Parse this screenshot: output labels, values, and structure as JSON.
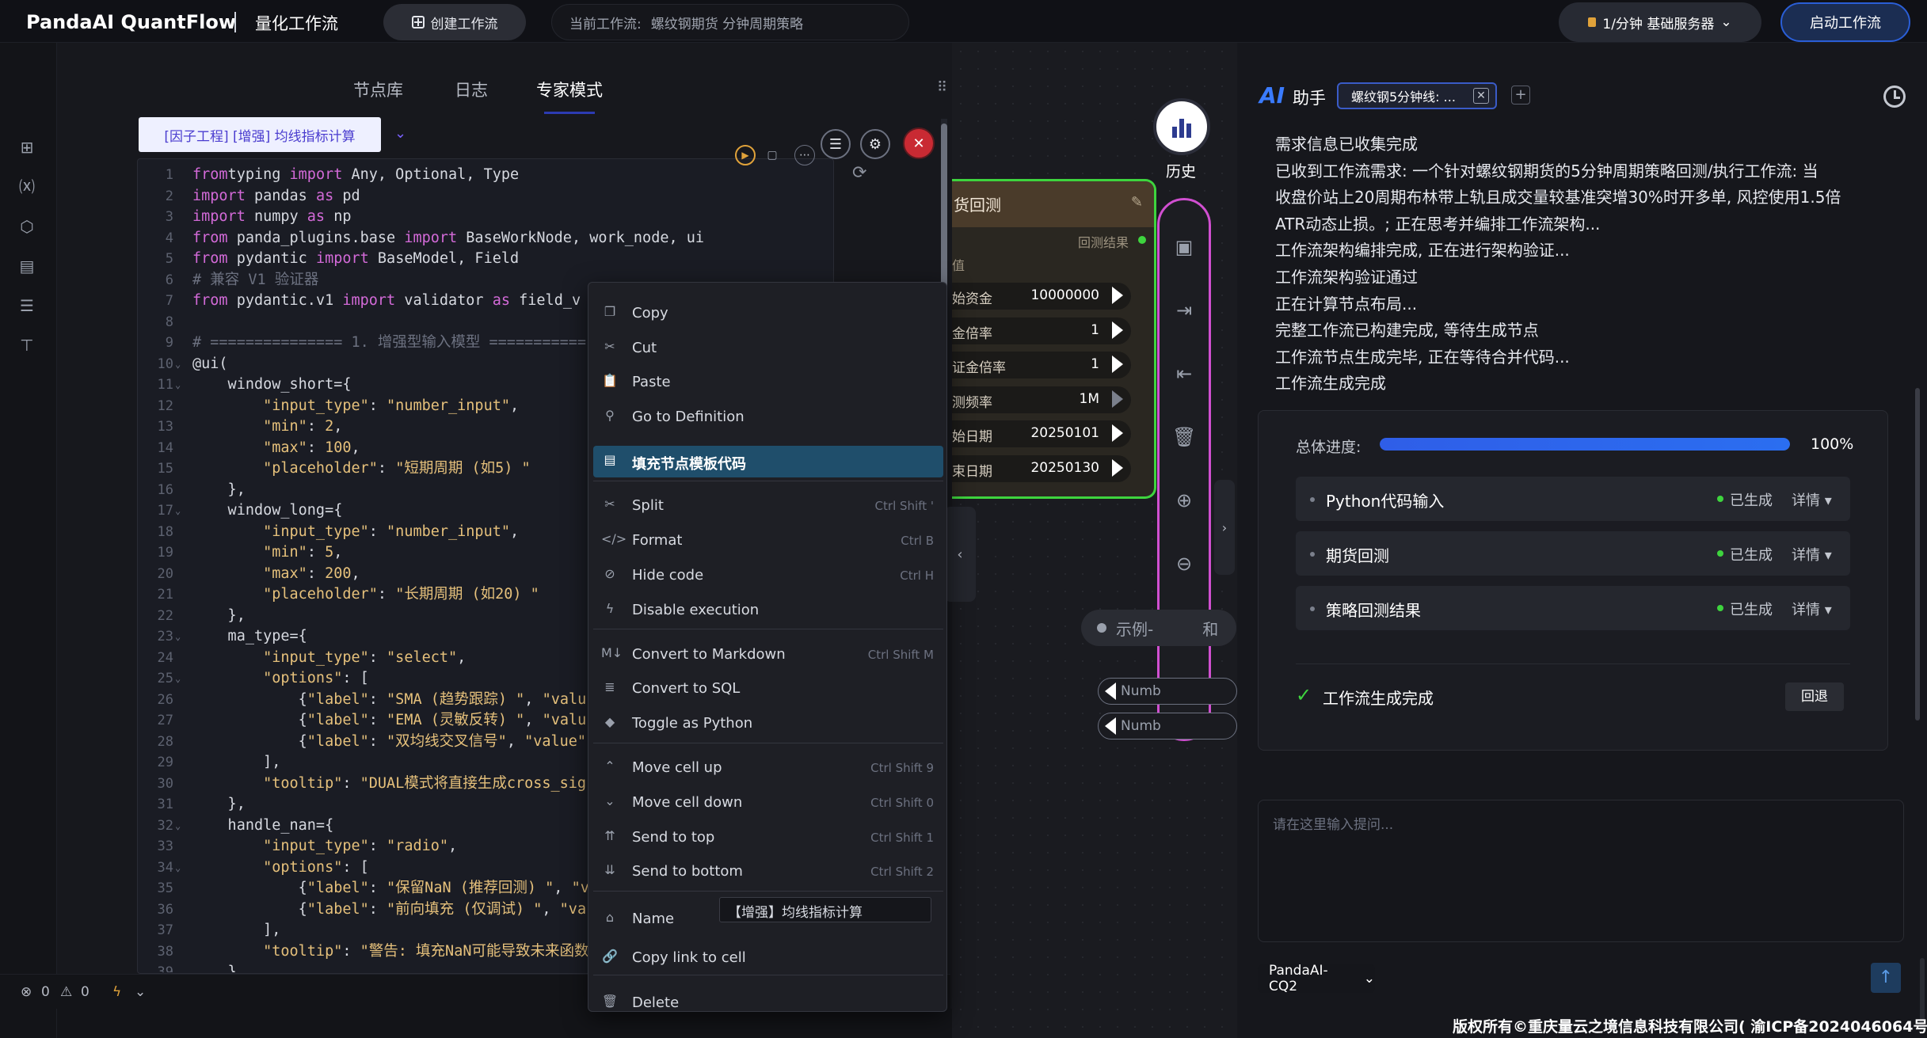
{
  "topbar": {
    "brand": "PandaAI QuantFlow",
    "subtitle": "量化工作流",
    "create_label": "创建工作流",
    "current_flow_label": "当前工作流:",
    "current_flow_value": "螺纹钢期货 分钟周期策略",
    "server_label": "1/分钟  基础服务器",
    "start_label": "启动工作流"
  },
  "editor": {
    "tabs": [
      "节点库",
      "日志",
      "专家模式"
    ],
    "active_tab": "专家模式",
    "cell_tag": "[因子工程] [增强] 均线指标计算",
    "lines": [
      {
        "n": "1",
        "t": [
          [
            "kw",
            "from"
          ],
          [
            "",
            "typing "
          ],
          [
            "kw",
            "import"
          ],
          [
            "",
            " Any, Optional, Type"
          ]
        ]
      },
      {
        "n": "2",
        "t": [
          [
            "kw",
            "import"
          ],
          [
            "",
            " pandas "
          ],
          [
            "kw",
            "as"
          ],
          [
            "",
            " pd"
          ]
        ]
      },
      {
        "n": "3",
        "t": [
          [
            "kw",
            "import"
          ],
          [
            "",
            " numpy "
          ],
          [
            "kw",
            "as"
          ],
          [
            "",
            " np"
          ]
        ]
      },
      {
        "n": "4",
        "t": [
          [
            "kw",
            "from"
          ],
          [
            "",
            " panda_plugins.base "
          ],
          [
            "kw",
            "import"
          ],
          [
            "",
            " BaseWorkNode, work_node, ui"
          ]
        ]
      },
      {
        "n": "5",
        "t": [
          [
            "kw",
            "from"
          ],
          [
            "",
            " pydantic "
          ],
          [
            "kw",
            "import"
          ],
          [
            "",
            " BaseModel, Field"
          ]
        ]
      },
      {
        "n": "6",
        "t": [
          [
            "cm",
            "# 兼容 V1 验证器"
          ]
        ]
      },
      {
        "n": "7",
        "t": [
          [
            "kw",
            "from"
          ],
          [
            "",
            " pydantic.v1 "
          ],
          [
            "kw",
            "import"
          ],
          [
            "",
            " validator "
          ],
          [
            "kw",
            "as"
          ],
          [
            "",
            " field_v"
          ]
        ]
      },
      {
        "n": "8",
        "t": []
      },
      {
        "n": "9",
        "t": [
          [
            "cm",
            "# =============== 1. 增强型输入模型 ==========="
          ]
        ]
      },
      {
        "n": "10",
        "f": true,
        "t": [
          [
            "",
            "@ui("
          ]
        ]
      },
      {
        "n": "11",
        "f": true,
        "t": [
          [
            "",
            "    window_short={"
          ]
        ]
      },
      {
        "n": "12",
        "t": [
          [
            "",
            "        "
          ],
          [
            "str",
            "\"input_type\""
          ],
          [
            "",
            ": "
          ],
          [
            "str",
            "\"number_input\""
          ],
          [
            "",
            ","
          ]
        ]
      },
      {
        "n": "13",
        "t": [
          [
            "",
            "        "
          ],
          [
            "str",
            "\"min\""
          ],
          [
            "",
            ": "
          ],
          [
            "num",
            "2"
          ],
          [
            "",
            ","
          ]
        ]
      },
      {
        "n": "14",
        "t": [
          [
            "",
            "        "
          ],
          [
            "str",
            "\"max\""
          ],
          [
            "",
            ": "
          ],
          [
            "num",
            "100"
          ],
          [
            "",
            ","
          ]
        ]
      },
      {
        "n": "15",
        "t": [
          [
            "",
            "        "
          ],
          [
            "str",
            "\"placeholder\""
          ],
          [
            "",
            ": "
          ],
          [
            "str",
            "\"短期周期 (如5) \""
          ]
        ]
      },
      {
        "n": "16",
        "t": [
          [
            "",
            "    },"
          ]
        ]
      },
      {
        "n": "17",
        "f": true,
        "t": [
          [
            "",
            "    window_long={"
          ]
        ]
      },
      {
        "n": "18",
        "t": [
          [
            "",
            "        "
          ],
          [
            "str",
            "\"input_type\""
          ],
          [
            "",
            ": "
          ],
          [
            "str",
            "\"number_input\""
          ],
          [
            "",
            ","
          ]
        ]
      },
      {
        "n": "19",
        "t": [
          [
            "",
            "        "
          ],
          [
            "str",
            "\"min\""
          ],
          [
            "",
            ": "
          ],
          [
            "num",
            "5"
          ],
          [
            "",
            ","
          ]
        ]
      },
      {
        "n": "20",
        "t": [
          [
            "",
            "        "
          ],
          [
            "str",
            "\"max\""
          ],
          [
            "",
            ": "
          ],
          [
            "num",
            "200"
          ],
          [
            "",
            ","
          ]
        ]
      },
      {
        "n": "21",
        "t": [
          [
            "",
            "        "
          ],
          [
            "str",
            "\"placeholder\""
          ],
          [
            "",
            ": "
          ],
          [
            "str",
            "\"长期周期 (如20) \""
          ]
        ]
      },
      {
        "n": "22",
        "t": [
          [
            "",
            "    },"
          ]
        ]
      },
      {
        "n": "23",
        "f": true,
        "t": [
          [
            "",
            "    ma_type={"
          ]
        ]
      },
      {
        "n": "24",
        "t": [
          [
            "",
            "        "
          ],
          [
            "str",
            "\"input_type\""
          ],
          [
            "",
            ": "
          ],
          [
            "str",
            "\"select\""
          ],
          [
            "",
            ","
          ]
        ]
      },
      {
        "n": "25",
        "f": true,
        "t": [
          [
            "",
            "        "
          ],
          [
            "str",
            "\"options\""
          ],
          [
            "",
            ": ["
          ]
        ]
      },
      {
        "n": "26",
        "t": [
          [
            "",
            "            {"
          ],
          [
            "str",
            "\"label\""
          ],
          [
            "",
            ": "
          ],
          [
            "str",
            "\"SMA (趋势跟踪) \""
          ],
          [
            "",
            ", "
          ],
          [
            "str",
            "\"valu"
          ]
        ]
      },
      {
        "n": "27",
        "t": [
          [
            "",
            "            {"
          ],
          [
            "str",
            "\"label\""
          ],
          [
            "",
            ": "
          ],
          [
            "str",
            "\"EMA (灵敏反转) \""
          ],
          [
            "",
            ", "
          ],
          [
            "str",
            "\"valu"
          ]
        ]
      },
      {
        "n": "28",
        "t": [
          [
            "",
            "            {"
          ],
          [
            "str",
            "\"label\""
          ],
          [
            "",
            ": "
          ],
          [
            "str",
            "\"双均线交叉信号\""
          ],
          [
            "",
            ", "
          ],
          [
            "str",
            "\"value\""
          ]
        ]
      },
      {
        "n": "29",
        "t": [
          [
            "",
            "        ],"
          ]
        ]
      },
      {
        "n": "30",
        "t": [
          [
            "",
            "        "
          ],
          [
            "str",
            "\"tooltip\""
          ],
          [
            "",
            ": "
          ],
          [
            "str",
            "\"DUAL模式将直接生成cross_sig"
          ]
        ]
      },
      {
        "n": "31",
        "t": [
          [
            "",
            "    },"
          ]
        ]
      },
      {
        "n": "32",
        "f": true,
        "t": [
          [
            "",
            "    handle_nan={"
          ]
        ]
      },
      {
        "n": "33",
        "t": [
          [
            "",
            "        "
          ],
          [
            "str",
            "\"input_type\""
          ],
          [
            "",
            ": "
          ],
          [
            "str",
            "\"radio\""
          ],
          [
            "",
            ","
          ]
        ]
      },
      {
        "n": "34",
        "f": true,
        "t": [
          [
            "",
            "        "
          ],
          [
            "str",
            "\"options\""
          ],
          [
            "",
            ": ["
          ]
        ]
      },
      {
        "n": "35",
        "t": [
          [
            "",
            "            {"
          ],
          [
            "str",
            "\"label\""
          ],
          [
            "",
            ": "
          ],
          [
            "str",
            "\"保留NaN (推荐回测) \""
          ],
          [
            "",
            ", "
          ],
          [
            "str",
            "\"v"
          ]
        ]
      },
      {
        "n": "36",
        "t": [
          [
            "",
            "            {"
          ],
          [
            "str",
            "\"label\""
          ],
          [
            "",
            ": "
          ],
          [
            "str",
            "\"前向填充 (仅调试) \""
          ],
          [
            "",
            ", "
          ],
          [
            "str",
            "\"va"
          ]
        ]
      },
      {
        "n": "37",
        "t": [
          [
            "",
            "        ],"
          ]
        ]
      },
      {
        "n": "38",
        "t": [
          [
            "",
            "        "
          ],
          [
            "str",
            "\"tooltip\""
          ],
          [
            "",
            ": "
          ],
          [
            "str",
            "\"警告: 填充NaN可能导致未来函数"
          ]
        ]
      },
      {
        "n": "39",
        "t": [
          [
            "",
            "    }"
          ]
        ]
      }
    ]
  },
  "status": {
    "errors": "0",
    "warnings": "0"
  },
  "context_menu": {
    "items": [
      {
        "icon": "copy-icon",
        "glyph": "❐",
        "label": "Copy",
        "shortcut": ""
      },
      {
        "icon": "cut-icon",
        "glyph": "✂",
        "label": "Cut",
        "shortcut": ""
      },
      {
        "icon": "paste-icon",
        "glyph": "📋",
        "label": "Paste",
        "shortcut": ""
      },
      {
        "icon": "search-icon",
        "glyph": "⚲",
        "label": "Go to Definition",
        "shortcut": ""
      },
      {
        "icon": "template-icon",
        "glyph": "▤",
        "label": "填充节点模板代码",
        "shortcut": "",
        "highlight": true
      },
      {
        "icon": "split-icon",
        "glyph": "✂",
        "label": "Split",
        "shortcut": "Ctrl Shift '"
      },
      {
        "icon": "format-icon",
        "glyph": "</>",
        "label": "Format",
        "shortcut": "Ctrl B"
      },
      {
        "icon": "hide-code-icon",
        "glyph": "⊘",
        "label": "Hide code",
        "shortcut": "Ctrl H"
      },
      {
        "icon": "bolt-icon",
        "glyph": "ϟ",
        "label": "Disable execution",
        "shortcut": ""
      },
      {
        "icon": "markdown-icon",
        "glyph": "M↓",
        "label": "Convert to Markdown",
        "shortcut": "Ctrl Shift M"
      },
      {
        "icon": "database-icon",
        "glyph": "≣",
        "label": "Convert to SQL",
        "shortcut": ""
      },
      {
        "icon": "python-icon",
        "glyph": "◆",
        "label": "Toggle as Python",
        "shortcut": ""
      },
      {
        "icon": "chevron-up-icon",
        "glyph": "⌃",
        "label": "Move cell up",
        "shortcut": "Ctrl Shift 9"
      },
      {
        "icon": "chevron-down-icon",
        "glyph": "⌄",
        "label": "Move cell down",
        "shortcut": "Ctrl Shift 0"
      },
      {
        "icon": "double-chevron-up-icon",
        "glyph": "⇈",
        "label": "Send to top",
        "shortcut": "Ctrl Shift 1"
      },
      {
        "icon": "double-chevron-down-icon",
        "glyph": "⇊",
        "label": "Send to bottom",
        "shortcut": "Ctrl Shift 2"
      },
      {
        "icon": "tag-icon",
        "glyph": "⌂",
        "label": "Name",
        "shortcut": ""
      },
      {
        "icon": "link-icon",
        "glyph": "🔗",
        "label": "Copy link to cell",
        "shortcut": ""
      },
      {
        "icon": "trash-icon",
        "glyph": "🗑",
        "label": "Delete",
        "shortcut": ""
      }
    ],
    "name_value": "【增强】均线指标计算"
  },
  "node": {
    "title": "货回测",
    "output_label": "回测结果",
    "section": "值",
    "params": [
      {
        "label": "始资金",
        "value": "10000000"
      },
      {
        "label": "金倍率",
        "value": "1"
      },
      {
        "label": "证金倍率",
        "value": "1"
      },
      {
        "label": "测频率",
        "value": "1M"
      },
      {
        "label": "始日期",
        "value": "20250101"
      },
      {
        "label": "束日期",
        "value": "20250130"
      }
    ]
  },
  "canvas": {
    "history_label": "历史",
    "example_label": "示例-",
    "example_suffix": "和",
    "numb_labels": [
      "Numb",
      "Numb"
    ]
  },
  "assistant": {
    "title": "助手",
    "chat_tab": "螺纹钢5分钟线: ...",
    "messages": [
      "需求信息已收集完成",
      "已收到工作流需求: 一个针对螺纹钢期货的5分钟周期策略回测/执行工作流: 当",
      "收盘价站上20周期布林带上轨且成交量较基准突增30%时开多单, 风控使用1.5倍",
      "ATR动态止损。; 正在思考并编排工作流架构...",
      "工作流架构编排完成, 正在进行架构验证...",
      "工作流架构验证通过",
      "正在计算节点布局...",
      "完整工作流已构建完成, 等待生成节点",
      "工作流节点生成完毕, 正在等待合并代码...",
      "工作流生成完成"
    ],
    "progress_label": "总体进度:",
    "progress_pct": "100%",
    "progress_value": 1.0,
    "steps": [
      {
        "name": "Python代码输入",
        "status": "已生成",
        "detail": "详情 ▾"
      },
      {
        "name": "期货回测",
        "status": "已生成",
        "detail": "详情 ▾"
      },
      {
        "name": "策略回测结果",
        "status": "已生成",
        "detail": "详情 ▾"
      }
    ],
    "done_label": "工作流生成完成",
    "rollback_label": "回退",
    "input_placeholder": "请在这里输入提问...",
    "model": "PandaAI-CQ2"
  },
  "footer": {
    "copyright": "版权所有©重庆量云之境信息科技有限公司( 渝ICP备2024046064号 )"
  },
  "colors": {
    "accent": "#2c3bb2",
    "run": "#e0a23a",
    "ok": "#3ed43e",
    "node_border": "#3ed43e",
    "tool_border": "#d14fd1",
    "close": "#c92a33"
  }
}
